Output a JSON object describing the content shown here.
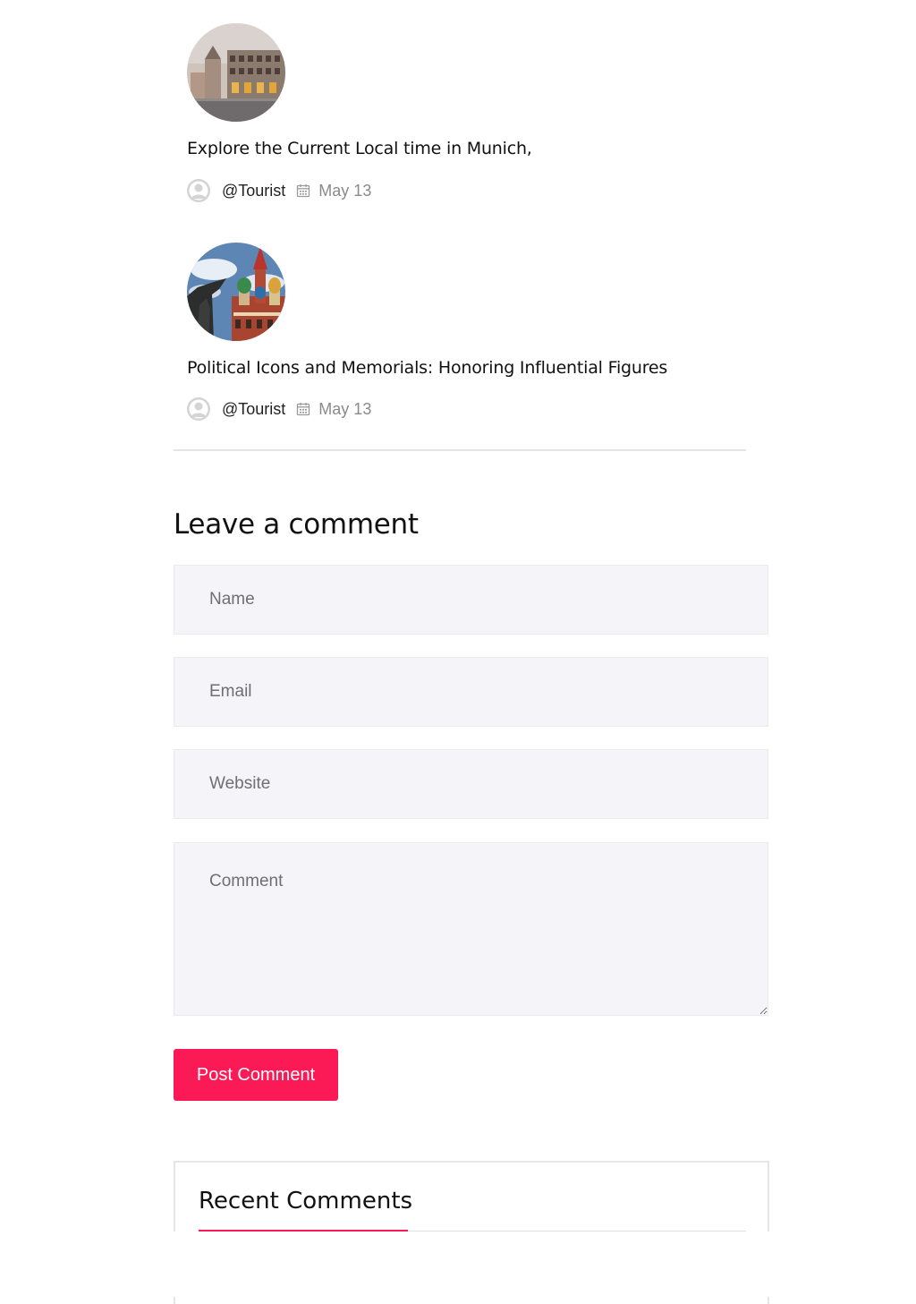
{
  "related_posts": [
    {
      "title": "Explore the Current Local time in Munich,",
      "author": "@Tourist",
      "date": "May 13",
      "thumbnail_icon": "munich-street-image"
    },
    {
      "title": "Political Icons and Memorials: Honoring Influential Figures",
      "author": "@Tourist",
      "date": "May 13",
      "thumbnail_icon": "moscow-cathedral-image"
    }
  ],
  "comment_form": {
    "heading": "Leave a comment",
    "name_placeholder": "Name",
    "email_placeholder": "Email",
    "website_placeholder": "Website",
    "comment_placeholder": "Comment",
    "submit_label": "Post Comment"
  },
  "sidebar_widget": {
    "title": "Recent Comments"
  },
  "colors": {
    "accent": "#fb1a55",
    "field_background": "#f5f5f9",
    "meta_gray": "#8a8a8a"
  }
}
